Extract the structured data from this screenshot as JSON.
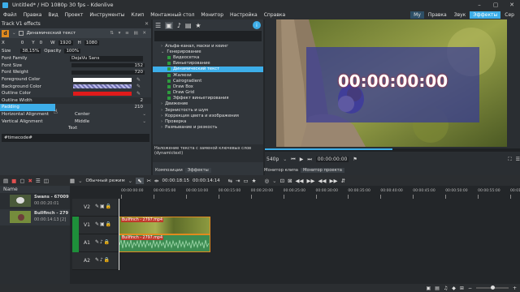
{
  "window": {
    "title": "Untitled* / HD 1080p 30 fps - Kdenlive"
  },
  "menu": {
    "items": [
      "Файл",
      "Правка",
      "Вид",
      "Проект",
      "Инструменты",
      "Клип",
      "Монтажный стол",
      "Монитор",
      "Настройка",
      "Справка"
    ]
  },
  "workspaces": {
    "items": [
      "Му",
      "Правка",
      "Звук",
      "Эффекты",
      "Сер"
    ],
    "active": "Эффекты"
  },
  "effect_panel": {
    "header": "Track V1 effects",
    "effect_name": "Динамический текст",
    "geometry": {
      "x_label": "X",
      "x": "0",
      "y_label": "Y",
      "y": "0",
      "w_label": "W",
      "w": "1920",
      "h_label": "H",
      "h": "1080"
    },
    "size": {
      "label": "Size",
      "value": "38,15%",
      "opacity_label": "Opacity",
      "opacity": "100%"
    },
    "params": [
      {
        "label": "Font Family",
        "value": "DejaVu Sans"
      },
      {
        "label": "Font Size",
        "value": "152"
      },
      {
        "label": "Font Weight",
        "value": "720"
      },
      {
        "label": "Foreground Color",
        "value": ""
      },
      {
        "label": "Background Color",
        "value": ""
      },
      {
        "label": "Outline Color",
        "value": ""
      },
      {
        "label": "Outline Width",
        "value": "2"
      },
      {
        "label": "Padding",
        "value": "210"
      },
      {
        "label": "Horizontal Alignment",
        "value": "Center"
      },
      {
        "label": "Vertical Alignment",
        "value": "Middle"
      },
      {
        "label": "",
        "value": "Text"
      }
    ],
    "text_value": "#timecode#",
    "colors": {
      "foreground": "#ffffff",
      "outline": "#e01b1b"
    }
  },
  "effects_tree": {
    "items": [
      {
        "label": "Альфа-канал, маски и кеинг",
        "level": 0
      },
      {
        "label": "Генерирование",
        "level": 0
      },
      {
        "label": "Видеосетка",
        "level": 1
      },
      {
        "label": "Виньетирование",
        "level": 1
      },
      {
        "label": "Динамический текст",
        "level": 1,
        "selected": true
      },
      {
        "label": "Жалюзи",
        "level": 1
      },
      {
        "label": "Cairogradient",
        "level": 1
      },
      {
        "label": "Draw Box",
        "level": 1
      },
      {
        "label": "Draw Grid",
        "level": 1
      },
      {
        "label": "Эффект виньетирования",
        "level": 1
      },
      {
        "label": "Движение",
        "level": 0
      },
      {
        "label": "Зернистость и шум",
        "level": 0
      },
      {
        "label": "Коррекция цвета и изображения",
        "level": 0
      },
      {
        "label": "Проверка",
        "level": 0
      },
      {
        "label": "Размывание и резкость",
        "level": 0
      }
    ],
    "description": "Наложение текста с заменой ключевых слов (dynamictext)",
    "tabs": [
      "Композиции",
      "Эффекты"
    ]
  },
  "monitor": {
    "timecode_overlay": "00:00:00:00",
    "zoom": "540p",
    "position": "00:00:00:00",
    "tabs": [
      "Монитор клипа",
      "Монитор проекта"
    ]
  },
  "timeline": {
    "mode": "Обычный режим",
    "timecode": "00:00:18:15",
    "duration": "00:00:14:14",
    "ruler": [
      "00:00:00:00",
      "00:00:05:00",
      "00:00:10:00",
      "00:00:15:00",
      "00:00:20:00",
      "00:00:25:00",
      "00:00:30:00",
      "00:00:35:00",
      "00:00:40:00",
      "00:00:45:00",
      "00:00:50:00",
      "00:00:55:00",
      "00:01:00:00"
    ],
    "tracks": [
      "V2",
      "V1",
      "A1",
      "A2"
    ],
    "clips": [
      {
        "name": "Bullfinch - 2797.mp4",
        "track": "V1"
      },
      {
        "name": "Bullfinch - 2797.mp4",
        "track": "A1"
      }
    ]
  },
  "bin": {
    "header": "Name",
    "items": [
      {
        "name": "Swans - 67009",
        "duration": "00:00:20:01"
      },
      {
        "name": "Bullfinch - 279",
        "duration": "00:00:14:13 [2]"
      }
    ]
  }
}
